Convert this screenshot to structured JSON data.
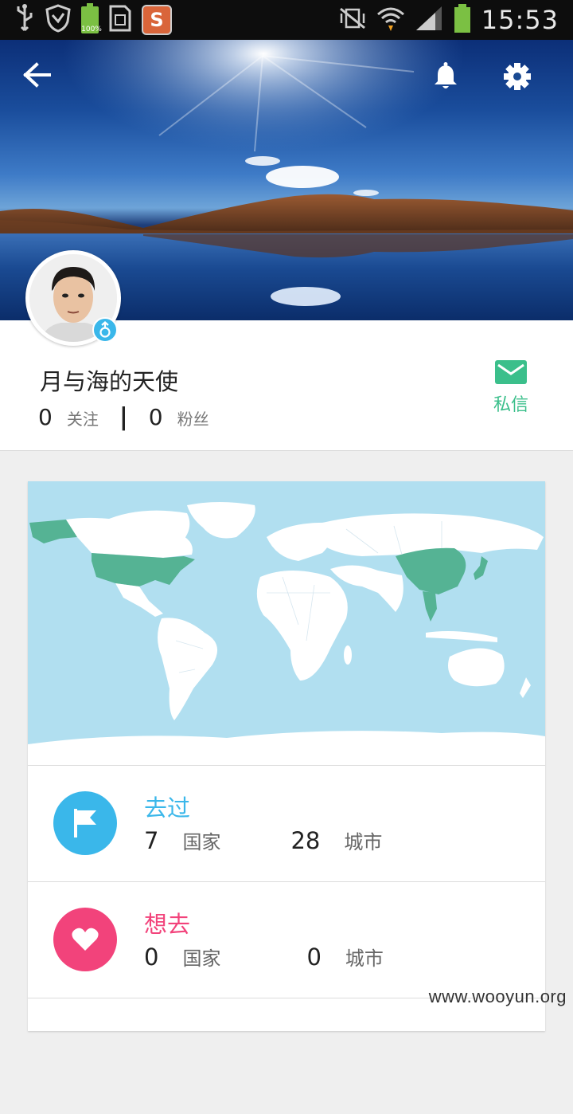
{
  "status_bar": {
    "time": "15:53",
    "battery_left_label": "100%",
    "sogou_label": "S"
  },
  "header": {
    "back_icon": "arrow-left-icon",
    "bell_icon": "bell-icon",
    "settings_icon": "gear-icon"
  },
  "profile": {
    "username": "月与海的天使",
    "following_count": "0",
    "following_label": "关注",
    "separator": "|",
    "followers_count": "0",
    "followers_label": "粉丝",
    "message_label": "私信",
    "gender_icon": "male-icon"
  },
  "visited": {
    "title": "去过",
    "countries_count": "7",
    "countries_label": "国家",
    "cities_count": "28",
    "cities_label": "城市",
    "color": "#3ab7ea"
  },
  "wishlist": {
    "title": "想去",
    "countries_count": "0",
    "countries_label": "国家",
    "cities_count": "0",
    "cities_label": "城市",
    "color": "#f2437b"
  },
  "colors": {
    "accent_green": "#3bbf8b",
    "map_ocean": "#b1dff0",
    "map_visited": "#55b394"
  },
  "watermark": "www.wooyun.org"
}
